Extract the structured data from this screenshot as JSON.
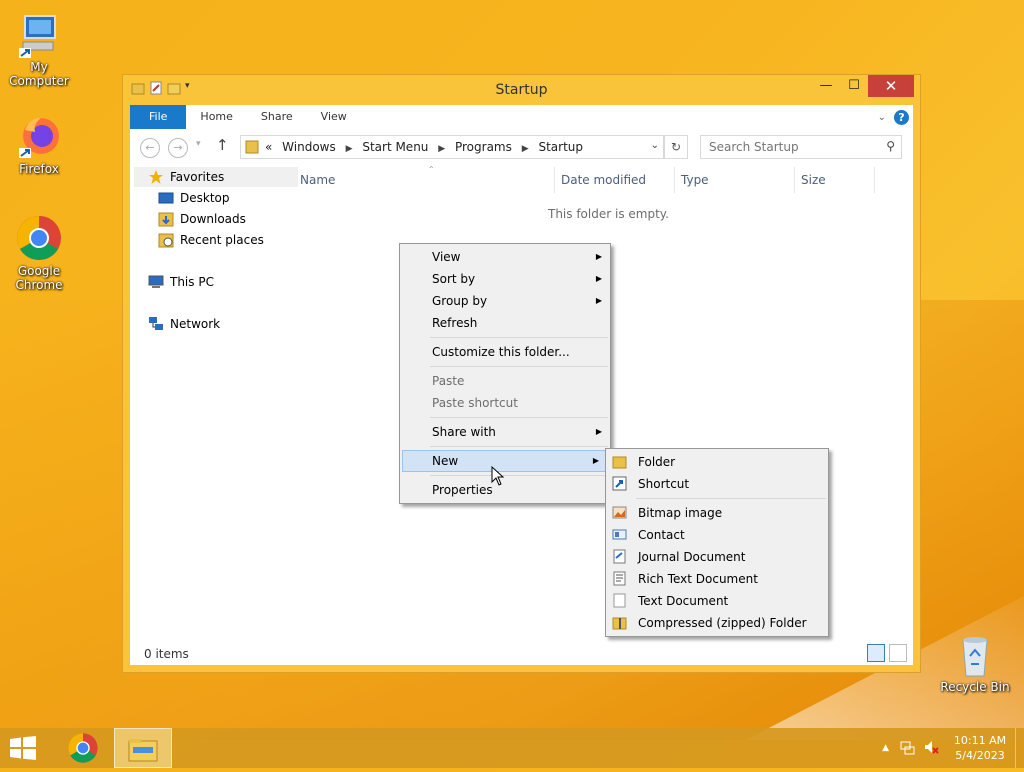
{
  "desktop": {
    "icons": [
      {
        "label": "My Computer"
      },
      {
        "label": "Firefox"
      },
      {
        "label": "Google Chrome"
      },
      {
        "label": "Recycle Bin"
      }
    ]
  },
  "window": {
    "title": "Startup",
    "ribbon_tabs": [
      "File",
      "Home",
      "Share",
      "View"
    ],
    "breadcrumb_prefix": "«",
    "breadcrumb": [
      "Windows",
      "Start Menu",
      "Programs",
      "Startup"
    ],
    "search_placeholder": "Search Startup",
    "nav": {
      "favorites": "Favorites",
      "desktop": "Desktop",
      "downloads": "Downloads",
      "recent": "Recent places",
      "thispc": "This PC",
      "network": "Network"
    },
    "columns": [
      "Name",
      "Date modified",
      "Type",
      "Size"
    ],
    "empty_message": "This folder is empty.",
    "status": "0 items"
  },
  "context_menu": {
    "items": [
      {
        "label": "View"
      },
      {
        "label": "Sort by"
      },
      {
        "label": "Group by"
      },
      {
        "label": "Refresh"
      },
      {
        "label": "Customize this folder..."
      },
      {
        "label": "Paste"
      },
      {
        "label": "Paste shortcut"
      },
      {
        "label": "Share with"
      },
      {
        "label": "New"
      },
      {
        "label": "Properties"
      }
    ]
  },
  "new_submenu": {
    "items": [
      {
        "label": "Folder",
        "icon": "folder-icon"
      },
      {
        "label": "Shortcut",
        "icon": "shortcut-icon"
      },
      {
        "label": "Bitmap image",
        "icon": "bitmap-icon"
      },
      {
        "label": "Contact",
        "icon": "contact-icon"
      },
      {
        "label": "Journal Document",
        "icon": "journal-icon"
      },
      {
        "label": "Rich Text Document",
        "icon": "richtext-icon"
      },
      {
        "label": "Text Document",
        "icon": "textdoc-icon"
      },
      {
        "label": "Compressed (zipped) Folder",
        "icon": "zip-folder-icon"
      }
    ]
  },
  "taskbar": {
    "time": "10:11 AM",
    "date": "5/4/2023"
  },
  "colors": {
    "accent": "#1979ca",
    "highlight": "#d1e3f5",
    "close_button": "#c7403a"
  }
}
